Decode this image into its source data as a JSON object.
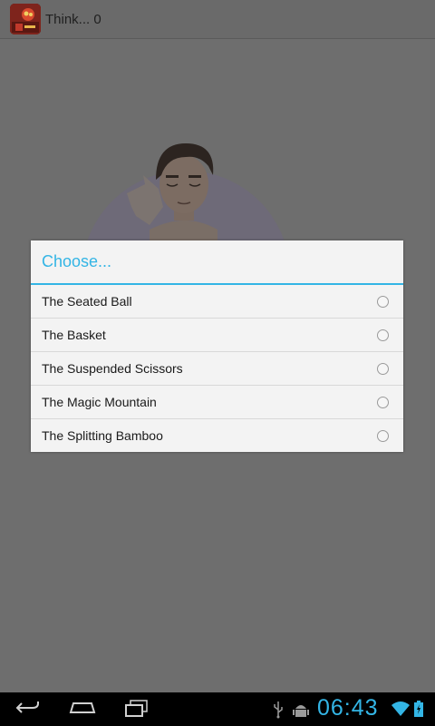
{
  "app": {
    "title": "Think... 0"
  },
  "dialog": {
    "title": "Choose...",
    "options": [
      {
        "label": "The Seated Ball",
        "selected": false
      },
      {
        "label": "The Basket",
        "selected": false
      },
      {
        "label": "The Suspended Scissors",
        "selected": false
      },
      {
        "label": "The Magic Mountain",
        "selected": false
      },
      {
        "label": "The Splitting Bamboo",
        "selected": false
      }
    ]
  },
  "status_bar": {
    "time": "06:43",
    "icons": [
      "usb-icon",
      "android-debug-icon",
      "wifi-icon",
      "battery-charging-icon"
    ]
  },
  "nav_bar": {
    "buttons": [
      "back-icon",
      "home-icon",
      "recent-apps-icon"
    ]
  },
  "colors": {
    "accent": "#33b5e5",
    "dialog_bg": "#f3f3f3",
    "background": "#6e6e6e"
  }
}
